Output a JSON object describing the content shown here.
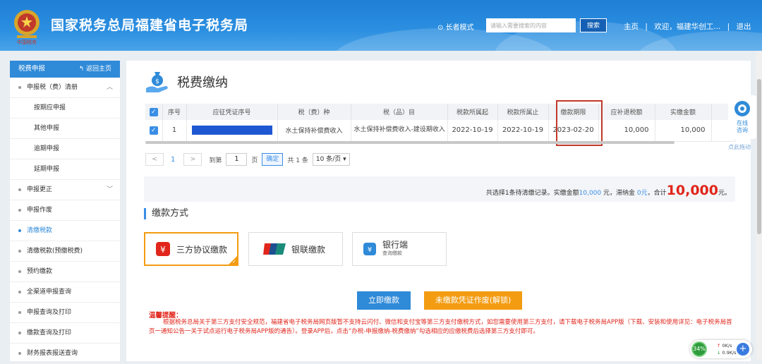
{
  "header": {
    "site_title": "国家税务总局福建省电子税务局",
    "elder_mode": "长者模式",
    "search_placeholder": "请输入需要搜索的内容",
    "search_button": "搜索",
    "nav_home": "主页",
    "nav_welcome": "欢迎，福建华创工...",
    "nav_logout": "退出",
    "sep": "|"
  },
  "sidebar": {
    "header": "税费申报",
    "back": "返回主页",
    "items": [
      {
        "label": "申报税（费）清册",
        "type": "group",
        "expanded": true
      },
      {
        "label": "按期应申报",
        "type": "sub"
      },
      {
        "label": "其他申报",
        "type": "sub"
      },
      {
        "label": "逾期申报",
        "type": "sub"
      },
      {
        "label": "延期申报",
        "type": "sub"
      },
      {
        "label": "申报更正",
        "type": "group",
        "expanded": false
      },
      {
        "label": "申报作废",
        "type": "item"
      },
      {
        "label": "清缴税款",
        "type": "item",
        "active": true
      },
      {
        "label": "清缴税款(预缴税费)",
        "type": "item"
      },
      {
        "label": "预约缴款",
        "type": "item"
      },
      {
        "label": "全渠道申报查询",
        "type": "item"
      },
      {
        "label": "申报查询及打印",
        "type": "item"
      },
      {
        "label": "缴款查询及打印",
        "type": "item"
      },
      {
        "label": "财务报表报送查询",
        "type": "item"
      }
    ]
  },
  "main": {
    "title": "税费缴纳",
    "table": {
      "headers": [
        "序号",
        "应征凭证序号",
        "税（费）种",
        "税（品）目",
        "税款所属起",
        "税款所属止",
        "缴款期限",
        "应补退税额",
        "实缴金额"
      ],
      "rows": [
        {
          "index": "1",
          "voucher": "",
          "tax_type": "水土保持补偿费收入",
          "tax_item": "水土保持补偿费收入-建设期收入",
          "start": "2022-10-19",
          "end": "2022-10-19",
          "deadline": "2023-02-20",
          "due": "10,000",
          "paid": "10,000"
        }
      ]
    },
    "pager": {
      "prev": "<",
      "current": "1",
      "next": ">",
      "goto": "到第",
      "page_value": "1",
      "page_unit": "页",
      "confirm": "确定",
      "total": "共 1 条",
      "page_size": "10 条/页"
    },
    "summary": {
      "part1": "共选择1条待清缴记录。实缴金额",
      "paid": "10,000",
      "part2": "元，滞纳金",
      "late": "0元",
      "part3": "，合计",
      "total": "10,000",
      "unit": "元。"
    },
    "payment": {
      "title": "缴款方式",
      "methods": [
        {
          "label": "三方协议缴款",
          "selected": true
        },
        {
          "label": "银联缴款",
          "selected": false
        },
        {
          "label": "银行端",
          "sub": "查询缴款",
          "selected": false
        }
      ]
    },
    "buttons": {
      "pay_now": "立即缴款",
      "void_voucher": "未缴款凭证作废(解锁)"
    },
    "warning": {
      "title": "温馨提醒：",
      "text": "根据税务总局关于第三方支付安全规范，福建省电子税务局网页版暂不支持云闪付、微信和支付宝等第三方支付缴税方式，如您需要使用第三方支付，请下载电子税务局APP版（下载、安装和使用详见：电子税务局首页一通知公告一关于试点运行电子税务局APP版的通告）。登录APP后，点击“办税-申报缴纳-税费缴纳”勾选相应的应缴税费后选择第三方支付即可。"
    }
  },
  "float": {
    "help": "在线咨询",
    "drag": "点此拖动"
  },
  "speed": {
    "percent": "34%",
    "up": "0K/s",
    "down": "0.9K/s"
  },
  "colors": {
    "header_blue": "#1e7fd6",
    "accent_blue": "#3a8ee6",
    "orange": "#f39c12",
    "red": "#e1251b"
  }
}
